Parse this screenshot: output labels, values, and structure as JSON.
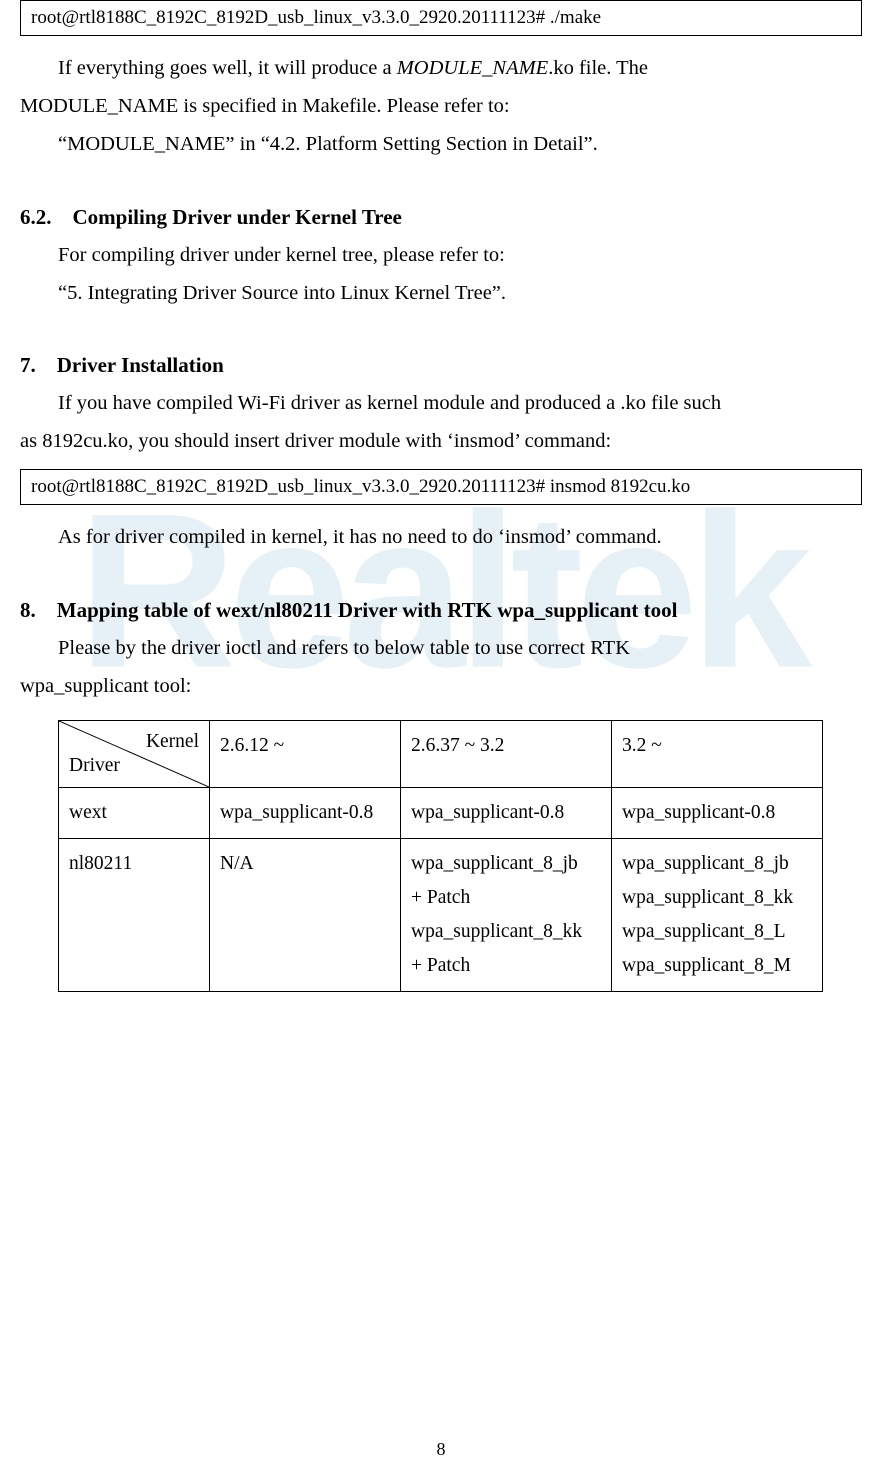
{
  "watermark": "Realtek",
  "cmd1": "root@rtl8188C_8192C_8192D_usb_linux_v3.3.0_2920.20111123# ./make",
  "p1_a": "If everything goes well, it will produce a ",
  "p1_i": "MODULE_NAME",
  "p1_b": ".ko file. The",
  "p2": "MODULE_NAME is specified in Makefile. Please refer to:",
  "p3": "“MODULE_NAME” in “4.2. Platform Setting Section in Detail”.",
  "h62": "6.2. Compiling Driver under Kernel Tree",
  "p4": "For compiling driver under kernel tree, please refer to:",
  "p5": "“5. Integrating Driver Source into Linux Kernel Tree”.",
  "h7": "7. Driver Installation",
  "p6": "If you have compiled Wi-Fi driver as kernel module and produced a .ko file such",
  "p7": "as 8192cu.ko, you should insert driver module with ‘insmod’ command:",
  "cmd2": "root@rtl8188C_8192C_8192D_usb_linux_v3.3.0_2920.20111123# insmod 8192cu.ko",
  "p8": "As for driver compiled in kernel, it has no need to do ‘insmod’ command.",
  "h8": "8. Mapping table of wext/nl80211 Driver with RTK wpa_supplicant tool",
  "p9": "Please by the driver ioctl and refers to below table to use correct RTK",
  "p10": "wpa_supplicant tool:",
  "table": {
    "diag_top": "Kernel",
    "diag_bot": "Driver",
    "cols": [
      "2.6.12 ~",
      "2.6.37 ~ 3.2",
      "3.2 ~"
    ],
    "rows": [
      {
        "name": "wext",
        "c1": "wpa_supplicant-0.8",
        "c2": "wpa_supplicant-0.8",
        "c3": "wpa_supplicant-0.8"
      },
      {
        "name": "nl80211",
        "c1": "N/A",
        "c2": "wpa_supplicant_8_jb + Patch wpa_supplicant_8_kk + Patch",
        "c3": "wpa_supplicant_8_jb wpa_supplicant_8_kk wpa_supplicant_8_L wpa_supplicant_8_M"
      }
    ]
  },
  "pagenum": "8",
  "chart_data": {
    "type": "table",
    "title": "Mapping table of wext/nl80211 Driver with RTK wpa_supplicant tool",
    "row_header": "Driver",
    "col_header": "Kernel",
    "columns": [
      "2.6.12 ~",
      "2.6.37 ~ 3.2",
      "3.2 ~"
    ],
    "rows": [
      {
        "driver": "wext",
        "2.6.12 ~": "wpa_supplicant-0.8",
        "2.6.37 ~ 3.2": "wpa_supplicant-0.8",
        "3.2 ~": "wpa_supplicant-0.8"
      },
      {
        "driver": "nl80211",
        "2.6.12 ~": "N/A",
        "2.6.37 ~ 3.2": "wpa_supplicant_8_jb + Patch; wpa_supplicant_8_kk + Patch",
        "3.2 ~": "wpa_supplicant_8_jb; wpa_supplicant_8_kk; wpa_supplicant_8_L; wpa_supplicant_8_M"
      }
    ]
  }
}
